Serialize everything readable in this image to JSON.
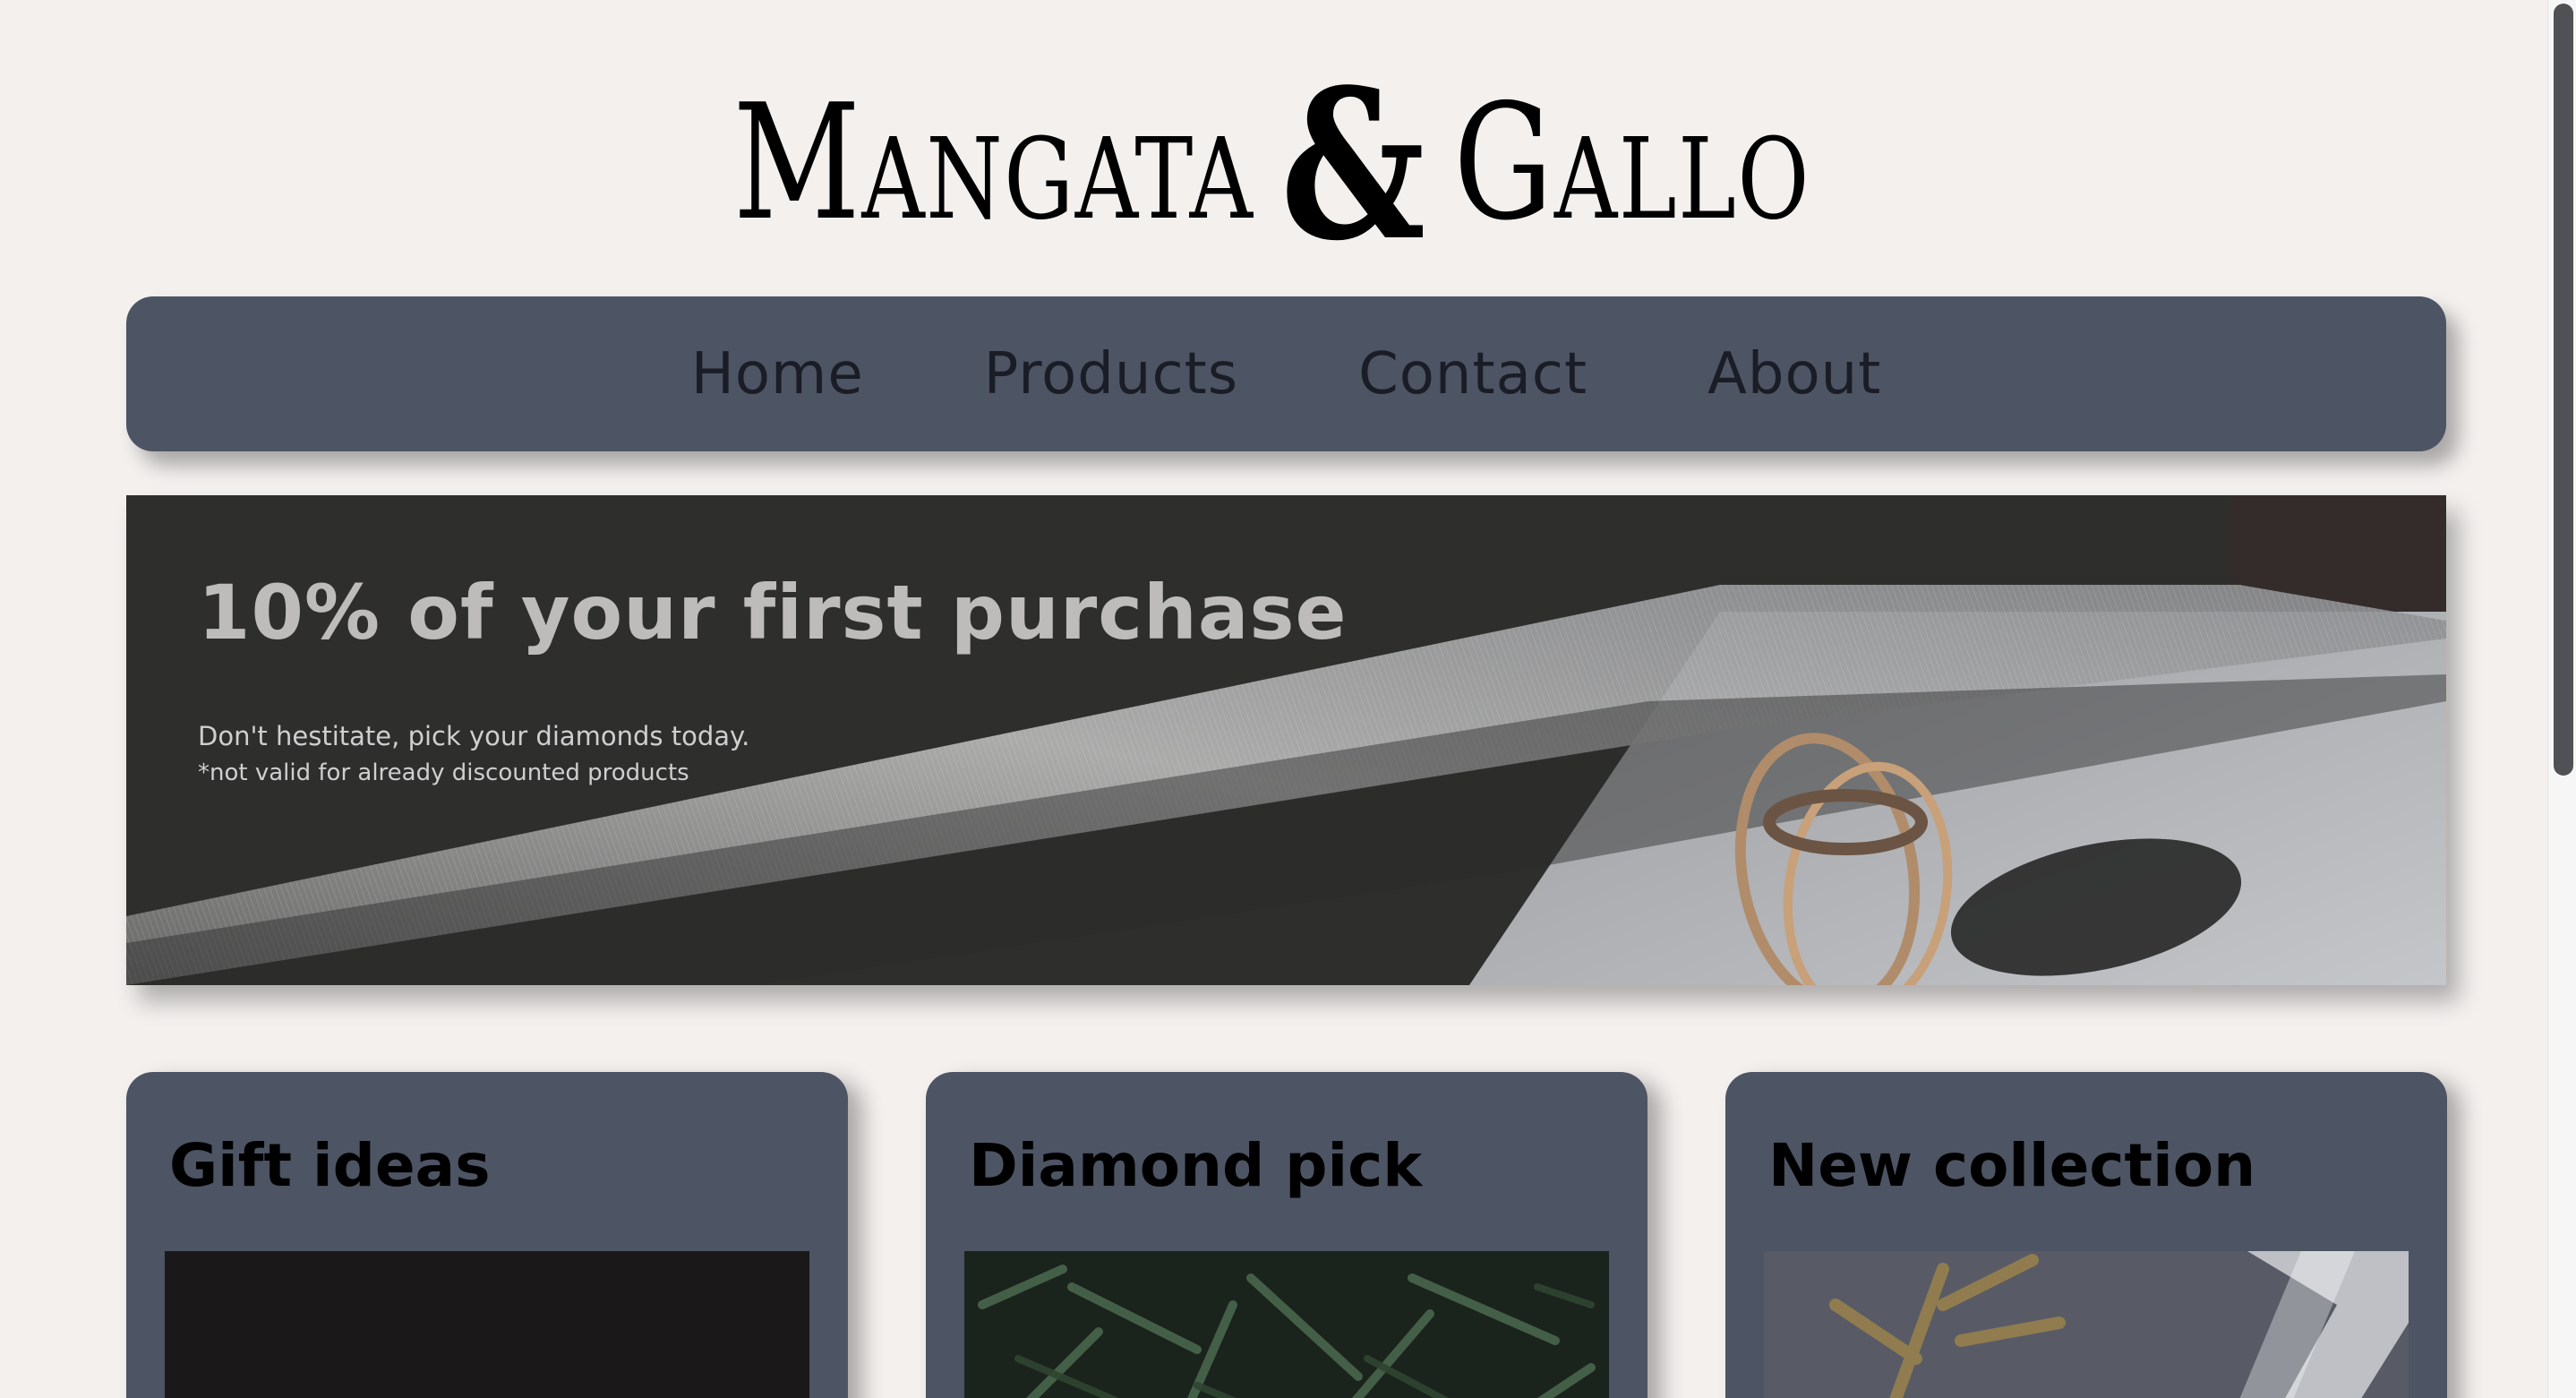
{
  "logo": {
    "left": "Mangata",
    "amp": "&",
    "right": "Gallo"
  },
  "nav": {
    "items": [
      {
        "label": "Home"
      },
      {
        "label": "Products"
      },
      {
        "label": "Contact"
      },
      {
        "label": "About"
      }
    ]
  },
  "hero": {
    "title": "10% of your first purchase",
    "subtitle": "Don't hestitate, pick your diamonds today.",
    "note": "*not valid for already discounted products"
  },
  "cards": [
    {
      "title": "Gift ideas"
    },
    {
      "title": "Diamond pick"
    },
    {
      "title": "New collection"
    }
  ],
  "colors": {
    "page_bg": "#f3f0ee",
    "panel": "#4d5463",
    "nav_text": "#1a1d26",
    "hero_title": "#bdbcbb"
  }
}
